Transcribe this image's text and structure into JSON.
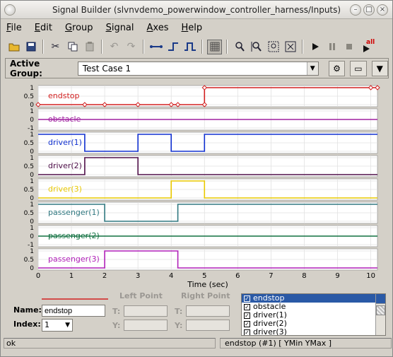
{
  "window": {
    "title": "Signal Builder (slvnvdemo_powerwindow_controller_harness/Inputs)"
  },
  "menubar": [
    {
      "label": "File",
      "hotkey": "F"
    },
    {
      "label": "Edit",
      "hotkey": "E"
    },
    {
      "label": "Group",
      "hotkey": "G"
    },
    {
      "label": "Signal",
      "hotkey": "S"
    },
    {
      "label": "Axes",
      "hotkey": "A"
    },
    {
      "label": "Help",
      "hotkey": "H"
    }
  ],
  "toolbar": {
    "run_all_label": "all",
    "icons": [
      "open-icon",
      "save-icon",
      "cut-icon",
      "copy-icon",
      "paste-icon",
      "undo-icon",
      "redo-icon",
      "add-line-icon",
      "add-step-icon",
      "add-pulse-icon",
      "grid-icon",
      "zoom-x-icon",
      "zoom-y-icon",
      "zoom-box-icon",
      "fit-icon",
      "play-icon",
      "pause-icon",
      "stop-icon",
      "run-all-icon"
    ]
  },
  "active_group": {
    "label": "Active Group:",
    "value": "Test Case 1"
  },
  "chart_data": {
    "type": "line",
    "xlabel": "Time (sec)",
    "xlim": [
      0,
      10.2
    ],
    "xticks": [
      0,
      1,
      2,
      3,
      4,
      5,
      6,
      7,
      8,
      9,
      10
    ],
    "series": [
      {
        "name": "endstop",
        "color": "#d22020",
        "ticks": [
          "1",
          "0.5",
          "0"
        ],
        "ylim": [
          0,
          1
        ],
        "x": [
          0,
          5,
          5,
          10.2
        ],
        "y": [
          0,
          0,
          1,
          1
        ],
        "markers": [
          [
            0,
            0
          ],
          [
            1.4,
            0
          ],
          [
            2,
            0
          ],
          [
            3,
            0
          ],
          [
            4,
            0
          ],
          [
            4.2,
            0
          ],
          [
            5,
            0
          ],
          [
            5,
            1
          ],
          [
            10,
            1
          ],
          [
            10.2,
            1
          ]
        ]
      },
      {
        "name": "obstacle",
        "color": "#a020a0",
        "ticks": [
          "1",
          "0",
          "-1"
        ],
        "ylim": [
          -1,
          1
        ],
        "x": [
          0,
          10.2
        ],
        "y": [
          0,
          0
        ]
      },
      {
        "name": "driver(1)",
        "color": "#1030d0",
        "ticks": [
          "1",
          "0.5",
          "0"
        ],
        "ylim": [
          0,
          1
        ],
        "x": [
          0,
          1.4,
          1.4,
          3,
          3,
          4,
          4,
          5,
          5,
          10.2
        ],
        "y": [
          1,
          1,
          0,
          0,
          1,
          1,
          0,
          0,
          1,
          1
        ]
      },
      {
        "name": "driver(2)",
        "color": "#50104a",
        "ticks": [
          "1",
          "0.5",
          "0"
        ],
        "ylim": [
          0,
          1
        ],
        "x": [
          0,
          1.4,
          1.4,
          3,
          3,
          10.2
        ],
        "y": [
          0,
          0,
          1,
          1,
          0,
          0
        ]
      },
      {
        "name": "driver(3)",
        "color": "#e8c800",
        "ticks": [
          "1",
          "0.5",
          "0"
        ],
        "ylim": [
          0,
          1
        ],
        "x": [
          0,
          4,
          4,
          5,
          5,
          10.2
        ],
        "y": [
          0,
          0,
          1,
          1,
          0,
          0
        ]
      },
      {
        "name": "passenger(1)",
        "color": "#307880",
        "ticks": [
          "1",
          "0.5",
          "0"
        ],
        "ylim": [
          0,
          1
        ],
        "x": [
          0,
          2,
          2,
          4,
          4,
          4.2,
          4.2,
          10.2
        ],
        "y": [
          1,
          1,
          0,
          0,
          0,
          0,
          1,
          1
        ]
      },
      {
        "name": "passenger(2)",
        "color": "#107040",
        "ticks": [
          "1",
          "0",
          "-1"
        ],
        "ylim": [
          -1,
          1
        ],
        "x": [
          0,
          10.2
        ],
        "y": [
          0,
          0
        ]
      },
      {
        "name": "passenger(3)",
        "color": "#b020b8",
        "ticks": [
          "1",
          "0.5",
          "0"
        ],
        "ylim": [
          0,
          1
        ],
        "x": [
          0,
          2,
          2,
          4.2,
          4.2,
          10.2
        ],
        "y": [
          0,
          0,
          1,
          1,
          0,
          0
        ]
      }
    ]
  },
  "editor": {
    "line_color": "#d22020",
    "left_point_label": "Left Point",
    "right_point_label": "Right Point",
    "name_label": "Name:",
    "name_value": "endstop",
    "index_label": "Index:",
    "index_value": "1",
    "t_label": "T:",
    "y_label": "Y:"
  },
  "signal_list": [
    {
      "label": "endstop",
      "checked": true,
      "selected": true
    },
    {
      "label": "obstacle",
      "checked": true,
      "selected": false
    },
    {
      "label": "driver(1)",
      "checked": true,
      "selected": false
    },
    {
      "label": "driver(2)",
      "checked": true,
      "selected": false
    },
    {
      "label": "driver(3)",
      "checked": true,
      "selected": false
    }
  ],
  "status": {
    "left": "ok",
    "right": "endstop (#1)  [ YMin YMax ]"
  }
}
